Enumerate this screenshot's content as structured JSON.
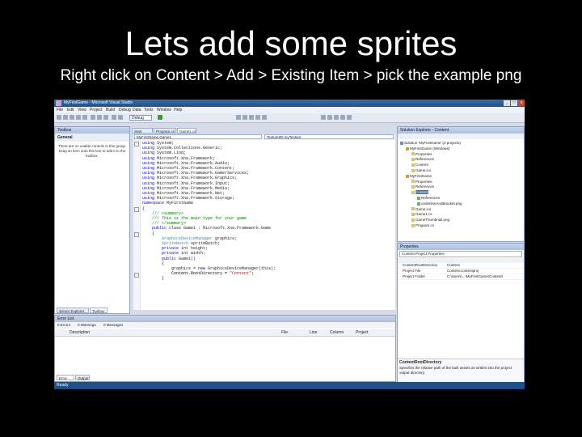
{
  "slide": {
    "title": "Lets add some sprites",
    "subtitle": "Right click on Content > Add > Existing Item > pick the example png"
  },
  "window": {
    "title": "MyFirstGame - Microsoft Visual Studio",
    "menu": [
      "File",
      "Edit",
      "View",
      "Project",
      "Build",
      "Debug",
      "Data",
      "Tools",
      "Window",
      "Help"
    ],
    "config": "Debug"
  },
  "toolbox": {
    "header": "Toolbox",
    "group": "General",
    "empty_text": "There are no usable controls in this group. Drag an item onto this text to add it to the toolbox.",
    "bottom_tabs": [
      "Server Explorer",
      "Toolbox"
    ]
  },
  "editor": {
    "tabs": [
      "Start Page",
      "Program.cs",
      "Game1.cs"
    ],
    "class_dropdown": "MyFirstGame.Game1",
    "member_dropdown": "Texture2D myTexture",
    "lines": [
      {
        "t": "using System;",
        "k": "using"
      },
      {
        "t": "using System.Collections.Generic;",
        "k": "using"
      },
      {
        "t": "using System.Linq;",
        "k": "using"
      },
      {
        "t": "using Microsoft.Xna.Framework;",
        "k": "using"
      },
      {
        "t": "using Microsoft.Xna.Framework.Audio;",
        "k": "using"
      },
      {
        "t": "using Microsoft.Xna.Framework.Content;",
        "k": "using"
      },
      {
        "t": "using Microsoft.Xna.Framework.GamerServices;",
        "k": "using"
      },
      {
        "t": "using Microsoft.Xna.Framework.Graphics;",
        "k": "using"
      },
      {
        "t": "using Microsoft.Xna.Framework.Input;",
        "k": "using"
      },
      {
        "t": "using Microsoft.Xna.Framework.Media;",
        "k": "using"
      },
      {
        "t": "using Microsoft.Xna.Framework.Net;",
        "k": "using"
      },
      {
        "t": "using Microsoft.Xna.Framework.Storage;",
        "k": "using"
      },
      {
        "t": "",
        "k": ""
      },
      {
        "t": "namespace MyFirstGame",
        "k": "namespace"
      },
      {
        "t": "{",
        "k": ""
      },
      {
        "t": "    /// <summary>",
        "k": "comment"
      },
      {
        "t": "    /// This is the main type for your game",
        "k": "comment"
      },
      {
        "t": "    /// </summary>",
        "k": "comment"
      },
      {
        "t": "    public class Game1 : Microsoft.Xna.Framework.Game",
        "k": "public"
      },
      {
        "t": "    {",
        "k": ""
      },
      {
        "t": "        GraphicsDeviceManager graphics;",
        "k": "type"
      },
      {
        "t": "        SpriteBatch spriteBatch;",
        "k": "type"
      },
      {
        "t": "",
        "k": ""
      },
      {
        "t": "        private int height;",
        "k": "private"
      },
      {
        "t": "        private int width;",
        "k": "private"
      },
      {
        "t": "",
        "k": ""
      },
      {
        "t": "        public Game1()",
        "k": "public"
      },
      {
        "t": "        {",
        "k": ""
      },
      {
        "t": "            graphics = new GraphicsDeviceManager(this);",
        "k": "new"
      },
      {
        "t": "            Content.RootDirectory = \"Content\";",
        "k": "string"
      },
      {
        "t": "        }",
        "k": ""
      }
    ]
  },
  "solution_explorer": {
    "header": "Solution Explorer - Content",
    "items": [
      {
        "label": "Solution 'MyFirstGame' (2 projects)",
        "indent": 0
      },
      {
        "label": "MyFirstGame (Windows)",
        "indent": 1
      },
      {
        "label": "Properties",
        "indent": 2
      },
      {
        "label": "References",
        "indent": 2
      },
      {
        "label": "Content",
        "indent": 2
      },
      {
        "label": "Game.ico",
        "indent": 2
      },
      {
        "label": "MyFirstGame",
        "indent": 1
      },
      {
        "label": "Properties",
        "indent": 2
      },
      {
        "label": "References",
        "indent": 2
      },
      {
        "label": "Content",
        "indent": 2
      },
      {
        "label": "References",
        "indent": 3
      },
      {
        "label": "underlineAndBracket.png",
        "indent": 3
      },
      {
        "label": "Game.ico",
        "indent": 2
      },
      {
        "label": "Game1.cs",
        "indent": 2
      },
      {
        "label": "GameThumbnail.png",
        "indent": 2
      },
      {
        "label": "Program.cs",
        "indent": 2
      }
    ]
  },
  "properties": {
    "header": "Properties",
    "selector": "Content Project Properties",
    "rows": [
      {
        "name": "ContentRootDirectory",
        "value": "Content"
      },
      {
        "name": "Project File",
        "value": "Content.contentproj"
      },
      {
        "name": "Project Folder",
        "value": "C:\\Users\\...\\MyFirstGame\\Content\\"
      }
    ],
    "desc_title": "ContentRootDirectory",
    "desc_text": "Specifies the relative path of the built assets as written into the project output directory."
  },
  "error_list": {
    "header": "Error List",
    "filters": [
      "0 Errors",
      "0 Warnings",
      "0 Messages"
    ],
    "columns": [
      "Description",
      "File",
      "Line",
      "Column",
      "Project"
    ],
    "bottom_tabs": [
      "Error List",
      "Output"
    ]
  },
  "status": "Ready"
}
